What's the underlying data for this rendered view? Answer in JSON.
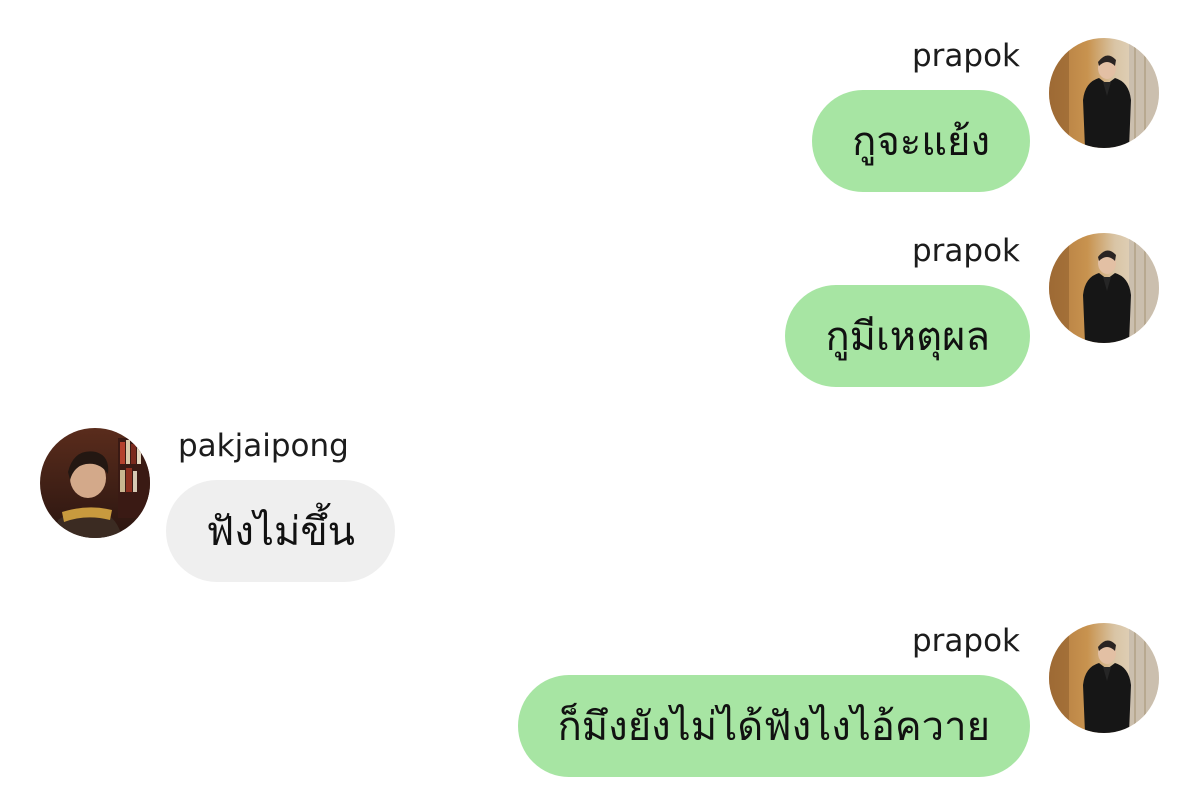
{
  "chat": {
    "messages": [
      {
        "sender": "prapok",
        "text": "กูจะแย้ง",
        "side": "outgoing",
        "avatar_icon": "man-in-black-coat-avatar"
      },
      {
        "sender": "prapok",
        "text": "กูมีเหตุผล",
        "side": "outgoing",
        "avatar_icon": "man-in-black-coat-avatar"
      },
      {
        "sender": "pakjaipong",
        "text": "ฟังไม่ขึ้น",
        "side": "incoming",
        "avatar_icon": "man-with-bookshelf-avatar"
      },
      {
        "sender": "prapok",
        "text": "ก็มึงยังไม่ได้ฟังไงไอ้ควาย",
        "side": "outgoing",
        "avatar_icon": "man-in-black-coat-avatar"
      }
    ]
  },
  "colors": {
    "outgoing_bubble": "#a7e5a3",
    "incoming_bubble": "#efefef",
    "background": "#ffffff"
  }
}
